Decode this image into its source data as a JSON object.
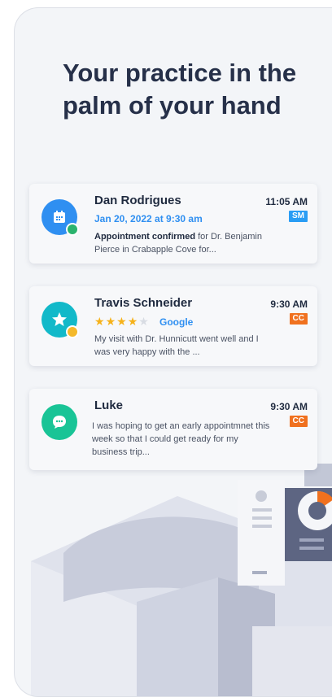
{
  "title": "Your practice in the palm of your hand",
  "colors": {
    "accent": "#2f8ff1",
    "badge_sm": "#2a9df4",
    "badge_cc": "#f0711f",
    "star": "#f6b21a"
  },
  "cards": [
    {
      "name": "Dan Rodrigues",
      "time": "11:05 AM",
      "badge": "SM",
      "subtitle": "Jan 20, 2022 at 9:30 am",
      "message_bold": "Appointment confirmed",
      "message_rest": " for Dr. Benjamin Pierce in Crabapple Cove for...",
      "icon": "calendar-icon",
      "status": "online"
    },
    {
      "name": "Travis Schneider",
      "time": "9:30 AM",
      "badge": "CC",
      "rating": 4,
      "rating_max": 5,
      "review_source": "Google",
      "message": "My visit with Dr. Hunnicutt went well and I was very happy with the ...",
      "icon": "star-icon",
      "status": "pending"
    },
    {
      "name": "Luke",
      "time": "9:30 AM",
      "badge": "CC",
      "message": "I was hoping to get an early appointmnet this week so that I could get ready for my business trip...",
      "icon": "chat-bubble-icon"
    }
  ]
}
